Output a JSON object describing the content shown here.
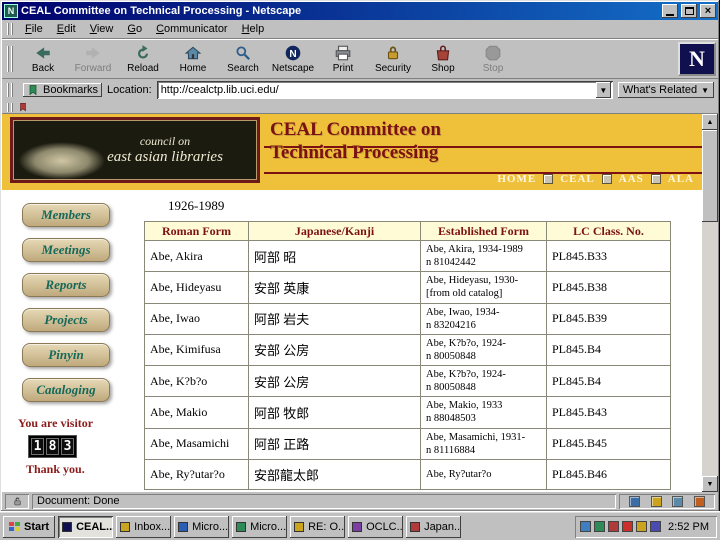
{
  "window": {
    "title": "CEAL Committee on Technical Processing - Netscape"
  },
  "menu": {
    "items": [
      "File",
      "Edit",
      "View",
      "Go",
      "Communicator",
      "Help"
    ]
  },
  "toolbar": {
    "buttons": [
      {
        "label": "Back",
        "icon": "back-icon",
        "enabled": true
      },
      {
        "label": "Forward",
        "icon": "forward-icon",
        "enabled": false
      },
      {
        "label": "Reload",
        "icon": "reload-icon",
        "enabled": true
      },
      {
        "label": "Home",
        "icon": "home-icon",
        "enabled": true
      },
      {
        "label": "Search",
        "icon": "search-icon",
        "enabled": true
      },
      {
        "label": "Netscape",
        "icon": "netscape-icon",
        "enabled": true
      },
      {
        "label": "Print",
        "icon": "print-icon",
        "enabled": true
      },
      {
        "label": "Security",
        "icon": "security-icon",
        "enabled": true
      },
      {
        "label": "Shop",
        "icon": "shop-icon",
        "enabled": true
      },
      {
        "label": "Stop",
        "icon": "stop-icon",
        "enabled": false
      }
    ],
    "logo_letter": "N"
  },
  "location_bar": {
    "bookmarks_label": "Bookmarks",
    "field_label": "Location:",
    "url": "http://cealctp.lib.uci.edu/",
    "whats_related_label": "What's Related"
  },
  "page": {
    "banner": {
      "site_line1": "council on",
      "site_line2": "east asian libraries",
      "title_line1": "CEAL Committee on",
      "title_line2": "Technical Processing",
      "nav_links": [
        "HOME",
        "CEAL",
        "AAS",
        "ALA"
      ],
      "gold_color": "#efc13b",
      "title_color": "#7b1113"
    },
    "sidebar": {
      "buttons": [
        "Members",
        "Meetings",
        "Reports",
        "Projects",
        "Pinyin",
        "Cataloging"
      ],
      "visitor_label": "You are visitor",
      "visitor_digits": [
        "1",
        "8",
        "3"
      ],
      "thank_you": "Thank you."
    },
    "main": {
      "heading": "1926-1989",
      "table": {
        "headers": [
          "Roman Form",
          "Japanese/Kanji",
          "Established Form",
          "LC Class. No."
        ],
        "rows": [
          {
            "roman": "Abe, Akira",
            "kanji": "阿部 昭",
            "established": "Abe, Akira, 1934-1989\nn 81042442",
            "lc": "PL845.B33"
          },
          {
            "roman": "Abe, Hideyasu",
            "kanji": "安部 英康",
            "established": "Abe, Hideyasu, 1930-\n[from old catalog]",
            "lc": "PL845.B38"
          },
          {
            "roman": "Abe, Iwao",
            "kanji": "阿部 岩夫",
            "established": "Abe, Iwao, 1934-\nn 83204216",
            "lc": "PL845.B39"
          },
          {
            "roman": "Abe, Kimifusa",
            "kanji": "安部 公房",
            "established": "Abe, K?b?o, 1924-\nn 80050848",
            "lc": "PL845.B4"
          },
          {
            "roman": "Abe, K?b?o",
            "kanji": "安部 公房",
            "established": "Abe, K?b?o, 1924-\nn 80050848",
            "lc": "PL845.B4"
          },
          {
            "roman": "Abe, Makio",
            "kanji": "阿部 牧郎",
            "established": "Abe, Makio, 1933\nn 88048503",
            "lc": "PL845.B43"
          },
          {
            "roman": "Abe, Masamichi",
            "kanji": "阿部 正路",
            "established": "Abe, Masamichi, 1931-\nn 81116884",
            "lc": "PL845.B45"
          },
          {
            "roman": "Abe, Ry?utar?o",
            "kanji": "安部龍太郎",
            "established": "Abe, Ry?utar?o",
            "lc": "PL845.B46"
          }
        ]
      }
    }
  },
  "status_bar": {
    "text": "Document: Done",
    "components": [
      {
        "name": "navigator-icon",
        "color": "#3a6ea5"
      },
      {
        "name": "mailbox-icon",
        "color": "#caa41f"
      },
      {
        "name": "discussions-icon",
        "color": "#5b8aa8"
      },
      {
        "name": "composer-icon",
        "color": "#c06020"
      }
    ]
  },
  "taskbar": {
    "start_label": "Start",
    "windows": [
      {
        "label": "CEAL...",
        "active": true,
        "color": "#10104e"
      },
      {
        "label": "Inbox...",
        "active": false,
        "color": "#caa41f"
      },
      {
        "label": "Micro...",
        "active": false,
        "color": "#2b5fb4"
      },
      {
        "label": "Micro...",
        "active": false,
        "color": "#2e8b57"
      },
      {
        "label": "RE: O...",
        "active": false,
        "color": "#caa41f"
      },
      {
        "label": "OCLC...",
        "active": false,
        "color": "#7a3fa0"
      },
      {
        "label": "Japan...",
        "active": false,
        "color": "#b03a3a"
      }
    ],
    "tray_icons": [
      {
        "name": "volume-icon",
        "color": "#3f7fbf"
      },
      {
        "name": "display-icon",
        "color": "#2e8b57"
      },
      {
        "name": "network-icon",
        "color": "#b03a3a"
      },
      {
        "name": "ime-icon",
        "color": "#c9302c"
      },
      {
        "name": "scheduler-icon",
        "color": "#caa41f"
      },
      {
        "name": "security-tray-icon",
        "color": "#4a4ab0"
      }
    ],
    "clock": "2:52 PM"
  }
}
